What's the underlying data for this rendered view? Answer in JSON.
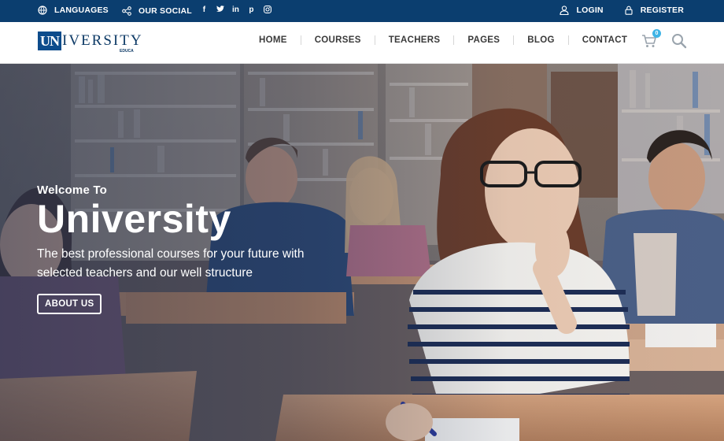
{
  "topbar": {
    "languages_label": "LANGUAGES",
    "social_label": "OUR SOCIAL",
    "social_icons": [
      "f",
      "t",
      "in",
      "p",
      "ig"
    ],
    "login_label": "LOGIN",
    "register_label": "REGISTER",
    "background": "#0b3e6f"
  },
  "header": {
    "logo_mark": "UN",
    "logo_text": "IVERSITY",
    "logo_sub": "EDUCA",
    "nav": [
      "HOME",
      "COURSES",
      "TEACHERS",
      "PAGES",
      "BLOG",
      "CONTACT"
    ],
    "cart_count": "0"
  },
  "hero": {
    "welcome": "Welcome To",
    "title": "University",
    "subtitle": "The best professional courses for your future with selected teachers and our well structure",
    "button_label": "ABOUT US"
  },
  "colors": {
    "brand_navy": "#0b3e6f",
    "accent_blue": "#3fb4e6"
  }
}
